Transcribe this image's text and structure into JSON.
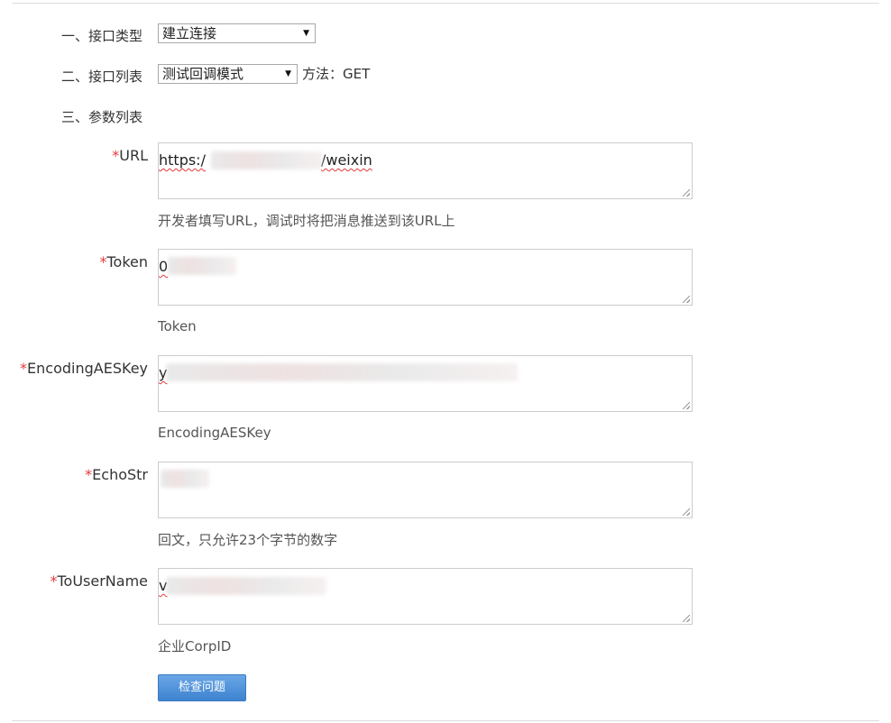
{
  "sections": {
    "interface_type_label": "一、接口类型",
    "interface_list_label": "二、接口列表",
    "param_list_label": "三、参数列表"
  },
  "interface_type": {
    "selected": "建立连接"
  },
  "interface_list": {
    "selected": "测试回调模式",
    "method_text": "方法：GET"
  },
  "fields": {
    "url": {
      "required_mark": "*",
      "label": "URL",
      "value_prefix": "https:/",
      "value_suffix": "/weixin",
      "hint": "开发者填写URL，调试时将把消息推送到该URL上"
    },
    "token": {
      "required_mark": "*",
      "label": "Token",
      "value_prefix": "0",
      "hint": "Token"
    },
    "aeskey": {
      "required_mark": "*",
      "label": "EncodingAESKey",
      "value_prefix": "y",
      "hint": "EncodingAESKey"
    },
    "echostr": {
      "required_mark": "*",
      "label": "EchoStr",
      "value_prefix": "",
      "hint": "回文，只允许23个字节的数字"
    },
    "tousername": {
      "required_mark": "*",
      "label": "ToUserName",
      "value_prefix": "v",
      "hint": "企业CorpID"
    }
  },
  "actions": {
    "check_button_label": "检查问题"
  },
  "colors": {
    "required_star": "#e4393c",
    "button_top": "#6aa6e6",
    "button_bottom": "#3d83cf"
  }
}
